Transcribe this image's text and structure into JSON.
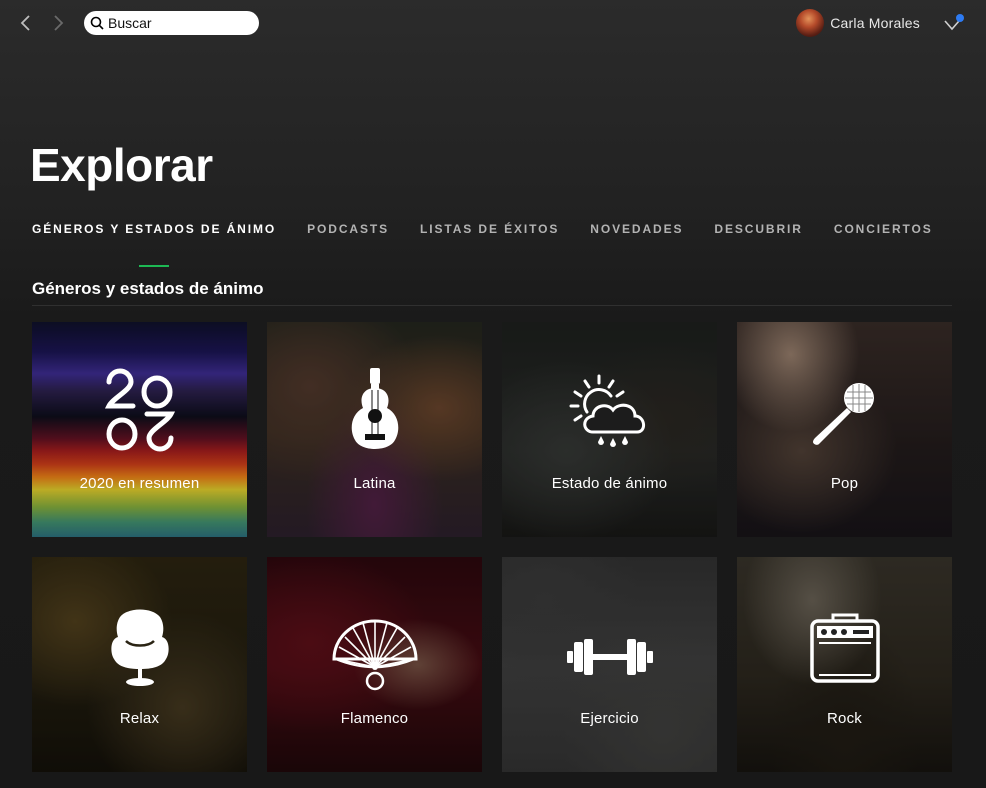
{
  "topbar": {
    "search_placeholder": "Buscar",
    "user_name": "Carla Morales"
  },
  "header": {
    "title": "Explorar",
    "tabs": [
      {
        "label": "GÉNEROS Y ESTADOS DE ÁNIMO",
        "active": true
      },
      {
        "label": "PODCASTS"
      },
      {
        "label": "LISTAS DE ÉXITOS"
      },
      {
        "label": "NOVEDADES"
      },
      {
        "label": "DESCUBRIR"
      },
      {
        "label": "CONCIERTOS"
      }
    ]
  },
  "section": {
    "title": "Géneros y estados de ánimo",
    "tiles": [
      {
        "label": "2020 en resumen",
        "icon": "2020-wrapped-icon"
      },
      {
        "label": "Latina",
        "icon": "guitar-icon"
      },
      {
        "label": "Estado de ánimo",
        "icon": "weather-icon"
      },
      {
        "label": "Pop",
        "icon": "microphone-icon"
      },
      {
        "label": "Relax",
        "icon": "egg-chair-icon"
      },
      {
        "label": "Flamenco",
        "icon": "fan-icon"
      },
      {
        "label": "Ejercicio",
        "icon": "dumbbell-icon"
      },
      {
        "label": "Rock",
        "icon": "amplifier-icon"
      }
    ]
  },
  "colors": {
    "accent": "#1db954",
    "notification": "#2d7bf3",
    "background": "#181818"
  }
}
